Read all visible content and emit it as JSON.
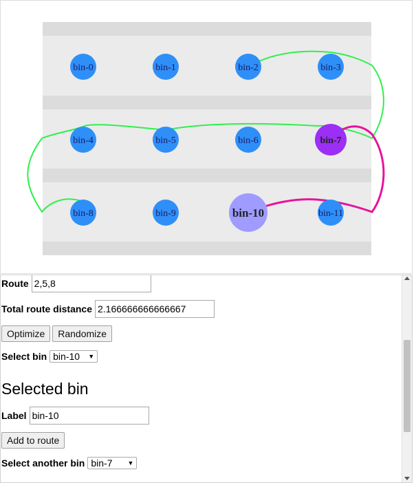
{
  "bins": [
    "bin-0",
    "bin-1",
    "bin-2",
    "bin-3",
    "bin-4",
    "bin-5",
    "bin-6",
    "bin-7",
    "bin-8",
    "bin-9",
    "bin-10",
    "bin-11"
  ],
  "selected_bin": "bin-10",
  "other_bin": "bin-7",
  "colors": {
    "bin": "#2f8ff8",
    "bin_selected": "#9f9bff",
    "bin_other": "#9b2ff5",
    "route_line": "#2ef04d",
    "link_line": "#e8129c",
    "aisle": "#ebebeb",
    "shelf": "#dcdcdc"
  },
  "form": {
    "route_label": "Route",
    "route_value": "2,5,8",
    "distance_label": "Total route distance",
    "distance_value": "2.166666666666667",
    "optimize_label": "Optimize",
    "randomize_label": "Randomize",
    "select_bin_label": "Select bin",
    "select_bin_value": "bin-10",
    "selected_bin_heading": "Selected bin",
    "label_label": "Label",
    "label_value": "bin-10",
    "add_to_route_label": "Add to route",
    "select_another_label": "Select another bin",
    "select_another_value": "bin-7"
  }
}
